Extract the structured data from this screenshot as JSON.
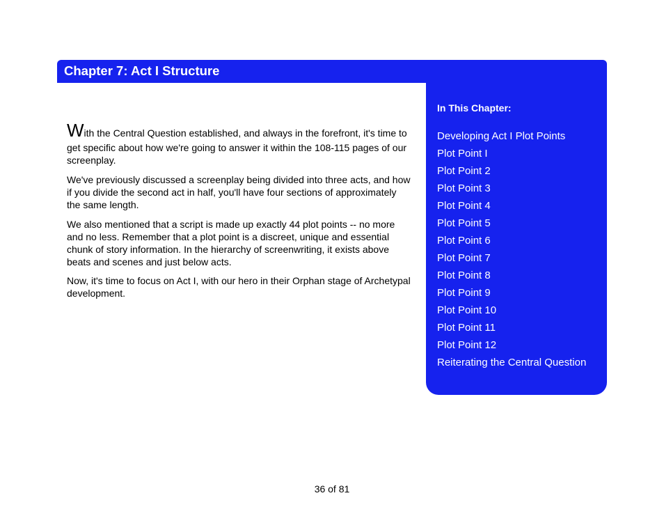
{
  "title": "Chapter 7: Act I Structure",
  "body": {
    "dropcap": "W",
    "p1_rest": "ith the Central Question established, and always in the forefront, it's time to get specific about how we're going to answer it within the 108-115 pages of our screenplay.",
    "p2": "We've previously discussed a screenplay being divided into three acts, and how if you divide the second act in half, you'll have four sections of approximately the same length.",
    "p3": "We also mentioned that a script is made up exactly 44 plot points -- no more and no less. Remember that a plot point is a discreet, unique and essential chunk of story information. In the hierarchy of screenwriting, it exists above beats and scenes and just below acts.",
    "p4": "Now, it's time to focus on Act I, with our hero in their Orphan stage of Archetypal development."
  },
  "sidebar": {
    "heading": "In This Chapter:",
    "items": [
      "Developing Act I Plot Points",
      "Plot Point I",
      "Plot Point 2",
      "Plot Point 3",
      "Plot Point 4",
      "Plot Point 5",
      "Plot Point 6",
      "Plot Point 7",
      "Plot Point 8",
      "Plot Point 9",
      "Plot Point 10",
      "Plot Point 11",
      "Plot Point 12",
      "Reiterating the Central Question"
    ]
  },
  "page_number": "36 of 81"
}
